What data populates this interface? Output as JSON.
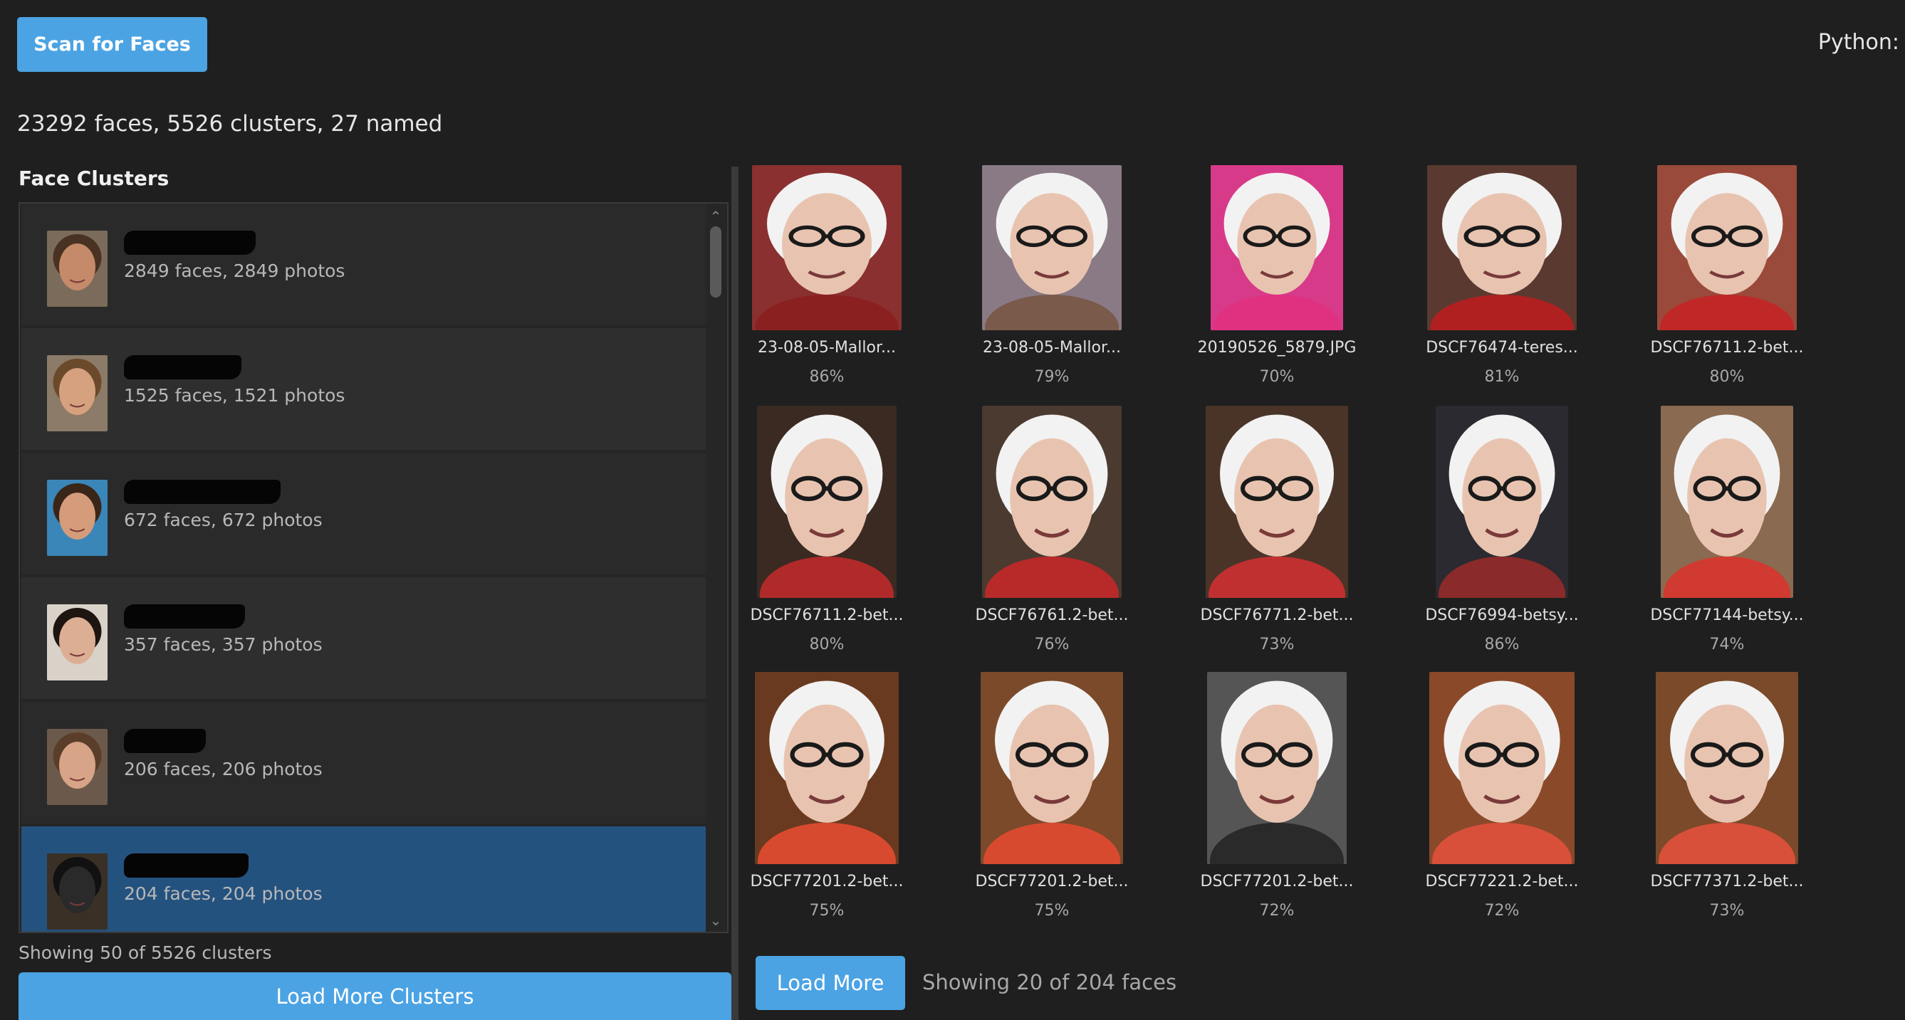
{
  "toolbar": {
    "scan_label": "Scan for Faces",
    "python_label": "Python:"
  },
  "stats": {
    "summary": "23292 faces, 5526 clusters, 27 named"
  },
  "clusters": {
    "heading": "Face Clusters",
    "items": [
      {
        "meta": "2849 faces, 2849 photos",
        "skin": "#c48a6a",
        "hair": "#4a3222",
        "bg": "#7b6b5a",
        "selected": false
      },
      {
        "meta": "1525 faces, 1521 photos",
        "skin": "#d6a17f",
        "hair": "#6b4a2c",
        "bg": "#8b7b68",
        "selected": false
      },
      {
        "meta": "672 faces, 672 photos",
        "skin": "#d49c7a",
        "hair": "#3a2618",
        "bg": "#3b86b8",
        "selected": false
      },
      {
        "meta": "357 faces, 357 photos",
        "skin": "#dcae93",
        "hair": "#1e1410",
        "bg": "#d8d2c8",
        "selected": false
      },
      {
        "meta": "206 faces, 206 photos",
        "skin": "#d7a488",
        "hair": "#5a3e2a",
        "bg": "#6b5a4b",
        "selected": false
      },
      {
        "meta": "204 faces, 204 photos",
        "skin": "#2a2a2a",
        "hair": "#111111",
        "bg": "#3a3026",
        "selected": true
      }
    ],
    "showing": "Showing 50 of 5526 clusters",
    "load_more_label": "Load More Clusters"
  },
  "faces": {
    "items": [
      {
        "name": "23-08-05-Mallor...",
        "score": "86%",
        "bg": "#8a3030",
        "cloth": "#8a2020"
      },
      {
        "name": "23-08-05-Mallor...",
        "score": "79%",
        "bg": "#8a7a86",
        "cloth": "#7a5a4a"
      },
      {
        "name": "20190526_5879.JPG",
        "score": "70%",
        "bg": "#d83a8a",
        "cloth": "#e03080"
      },
      {
        "name": "DSCF76474-teres...",
        "score": "81%",
        "bg": "#5a3a30",
        "cloth": "#b02020"
      },
      {
        "name": "DSCF76711.2-bet...",
        "score": "80%",
        "bg": "#9a4a3a",
        "cloth": "#c02828"
      },
      {
        "name": "DSCF76711.2-bet...",
        "score": "80%",
        "bg": "#3a2a22",
        "cloth": "#b02a2a"
      },
      {
        "name": "DSCF76761.2-bet...",
        "score": "76%",
        "bg": "#4a3a30",
        "cloth": "#b82a2a"
      },
      {
        "name": "DSCF76771.2-bet...",
        "score": "73%",
        "bg": "#4a3428",
        "cloth": "#c03030"
      },
      {
        "name": "DSCF76994-betsy...",
        "score": "86%",
        "bg": "#2a2a30",
        "cloth": "#8a2a2a"
      },
      {
        "name": "DSCF77144-betsy...",
        "score": "74%",
        "bg": "#8a6a50",
        "cloth": "#d03a30"
      },
      {
        "name": "DSCF77201.2-bet...",
        "score": "75%",
        "bg": "#6a3a20",
        "cloth": "#d84a30"
      },
      {
        "name": "DSCF77201.2-bet...",
        "score": "75%",
        "bg": "#7a4a2a",
        "cloth": "#d84a30"
      },
      {
        "name": "DSCF77201.2-bet...",
        "score": "72%",
        "bg": "#555555",
        "cloth": "#2a2a2a"
      },
      {
        "name": "DSCF77221.2-bet...",
        "score": "72%",
        "bg": "#8a4a2a",
        "cloth": "#d8503a"
      },
      {
        "name": "DSCF77371.2-bet...",
        "score": "73%",
        "bg": "#7a4a2a",
        "cloth": "#d8503a"
      }
    ],
    "load_more_label": "Load More",
    "showing": "Showing 20 of 204 faces"
  }
}
